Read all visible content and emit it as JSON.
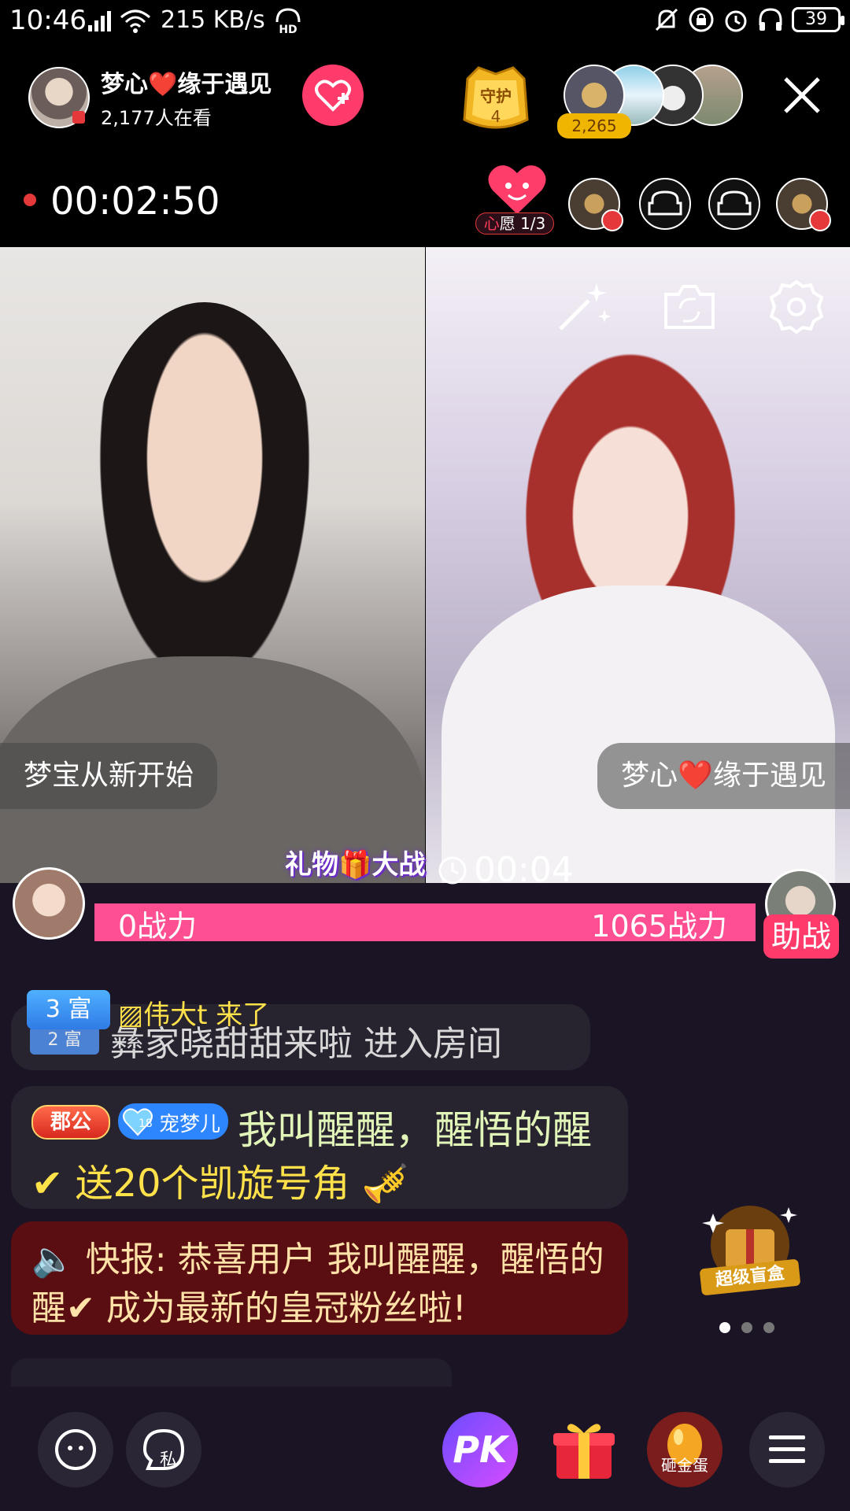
{
  "status_bar": {
    "time": "10:46",
    "network": "4G",
    "speed": "215 KB/s",
    "hd": "HD",
    "battery": "39"
  },
  "header": {
    "host_name": "梦心❤️缘于遇见",
    "viewers": "2,177人在看",
    "guard_label": "守护",
    "guard_count": "4",
    "gift_total": "2,265"
  },
  "timer": {
    "elapsed": "00:02:50",
    "wish_prefix": "心",
    "wish_label": "愿 1/3"
  },
  "video": {
    "left_name": "梦宝从新开始",
    "right_name": "梦心❤️缘于遇见"
  },
  "pk": {
    "battle_title": "礼物🎁大战",
    "countdown": "00:04",
    "left_power": "0战力",
    "right_power": "1065战力",
    "assist_label": "助战"
  },
  "chat": {
    "rich_badge": "3 富",
    "rich_badge2": "2 富",
    "arrive_text": "▨伟大t 来了",
    "enter_text": "彝家晓甜甜来啦 进入房间",
    "title_badge": "郡公",
    "fan_level": "18",
    "fan_name": "宠梦儿",
    "gift_user": "我叫醒醒，醒悟的醒",
    "gift_line": "✔ 送20个凯旋号角 🎺",
    "news_text": "🔈 快报: 恭喜用户 我叫醒醒，醒悟的醒✔ 成为最新的皇冠粉丝啦!"
  },
  "mystery_box": {
    "label": "超级盲盒"
  },
  "toolbar": {
    "pk_label": "PK",
    "private_label": "私",
    "egg_label": "砸金蛋"
  },
  "colors": {
    "accent_pink": "#fe3b6a",
    "pk_bar": "#fe4f93",
    "news_bg": "#5a0e12",
    "gold": "#ffe14a"
  }
}
